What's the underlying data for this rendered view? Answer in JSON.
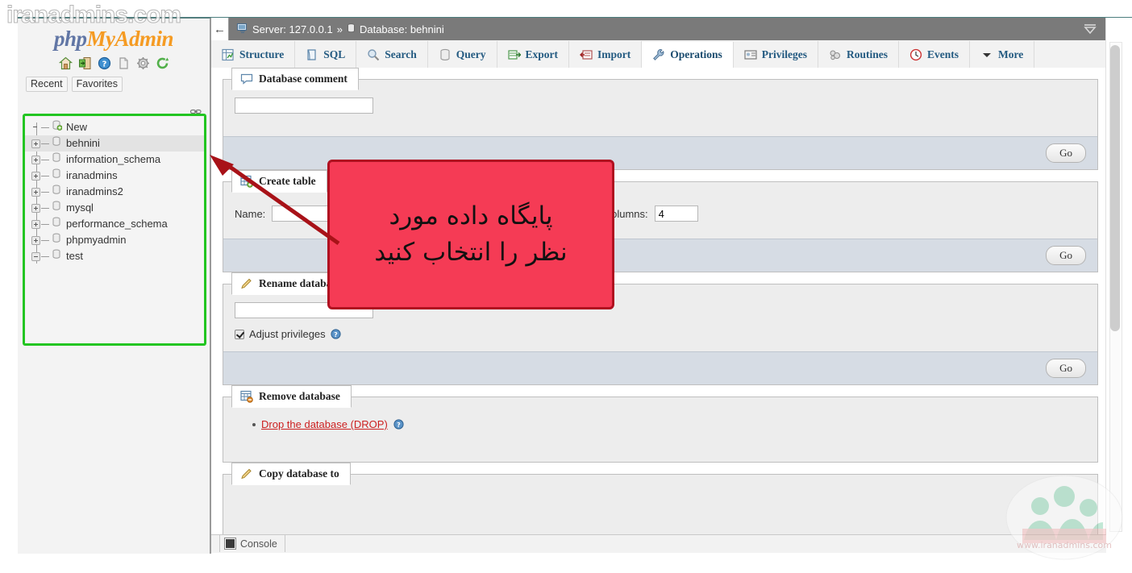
{
  "watermark": {
    "top_text": "iranadmins.com",
    "logo_caption": "www.iranadmins.com"
  },
  "sidebar": {
    "logo": {
      "part1": "php",
      "part2": "MyAdmin"
    },
    "icons": [
      {
        "name": "home-icon",
        "title": "Home"
      },
      {
        "name": "logout-icon",
        "title": "Log out"
      },
      {
        "name": "help-icon",
        "title": "phpMyAdmin documentation"
      },
      {
        "name": "docs-icon",
        "title": "Documentation"
      },
      {
        "name": "settings-gear-icon",
        "title": "Settings"
      },
      {
        "name": "reload-icon",
        "title": "Reload navigation"
      }
    ],
    "tabs": [
      {
        "label": "Recent"
      },
      {
        "label": "Favorites"
      }
    ],
    "link_icon": "chain-link-icon",
    "tree": [
      {
        "label": "New",
        "toggle": "none",
        "icon": "new-db-icon",
        "selected": false
      },
      {
        "label": "behnini",
        "toggle": "plus",
        "icon": "database-icon",
        "selected": true
      },
      {
        "label": "information_schema",
        "toggle": "plus",
        "icon": "database-icon",
        "selected": false
      },
      {
        "label": "iranadmins",
        "toggle": "plus",
        "icon": "database-icon",
        "selected": false
      },
      {
        "label": "iranadmins2",
        "toggle": "plus",
        "icon": "database-icon",
        "selected": false
      },
      {
        "label": "mysql",
        "toggle": "plus",
        "icon": "database-icon",
        "selected": false
      },
      {
        "label": "performance_schema",
        "toggle": "plus",
        "icon": "database-icon",
        "selected": false
      },
      {
        "label": "phpmyadmin",
        "toggle": "plus",
        "icon": "database-icon",
        "selected": false
      },
      {
        "label": "test",
        "toggle": "minus",
        "icon": "database-icon",
        "selected": false
      }
    ],
    "highlight_color": "#22c521"
  },
  "breadcrumb": {
    "back_arrow": "←",
    "server_label": "Server: 127.0.0.1",
    "separator": "»",
    "database_label": "Database: behnini",
    "collapse_icon": "collapse-up-icon"
  },
  "tabs": [
    {
      "label": "Structure",
      "icon": "structure-icon",
      "active": false
    },
    {
      "label": "SQL",
      "icon": "sql-icon",
      "active": false
    },
    {
      "label": "Search",
      "icon": "search-icon",
      "active": false
    },
    {
      "label": "Query",
      "icon": "query-icon",
      "active": false
    },
    {
      "label": "Export",
      "icon": "export-icon",
      "active": false
    },
    {
      "label": "Import",
      "icon": "import-icon",
      "active": false
    },
    {
      "label": "Operations",
      "icon": "operations-wrench-icon",
      "active": true
    },
    {
      "label": "Privileges",
      "icon": "privileges-icon",
      "active": false
    },
    {
      "label": "Routines",
      "icon": "routines-icon",
      "active": false
    },
    {
      "label": "Events",
      "icon": "events-clock-icon",
      "active": false
    },
    {
      "label": "More",
      "icon": "chevron-down-icon",
      "active": false
    }
  ],
  "panels": {
    "database_comment": {
      "legend": "Database comment",
      "icon": "comment-bubble-icon",
      "input_value": "",
      "go_label": "Go"
    },
    "create_table": {
      "legend": "Create table",
      "icon": "create-table-icon",
      "name_label": "Name:",
      "name_value": "",
      "columns_label": "Number of columns:",
      "columns_value": "4",
      "go_label": "Go"
    },
    "rename_database": {
      "legend": "Rename database to",
      "icon": "pencil-icon",
      "input_value": "",
      "adjust_privileges_label": "Adjust privileges",
      "adjust_privileges_checked": true,
      "help_icon": "help-circle-icon",
      "go_label": "Go"
    },
    "remove_database": {
      "legend": "Remove database",
      "icon": "remove-table-icon",
      "drop_link": "Drop the database (DROP)",
      "help_icon": "help-circle-icon"
    },
    "copy_database": {
      "legend": "Copy database to",
      "icon": "pencil-icon"
    }
  },
  "annotation": {
    "line1": "پایگاه داده مورد",
    "line2": "نظر را انتخاب کنید",
    "box_color": "#f53b55",
    "border_color": "#b01020",
    "arrow_color": "#a81218"
  },
  "console": {
    "label": "Console",
    "icon": "console-square-icon"
  }
}
